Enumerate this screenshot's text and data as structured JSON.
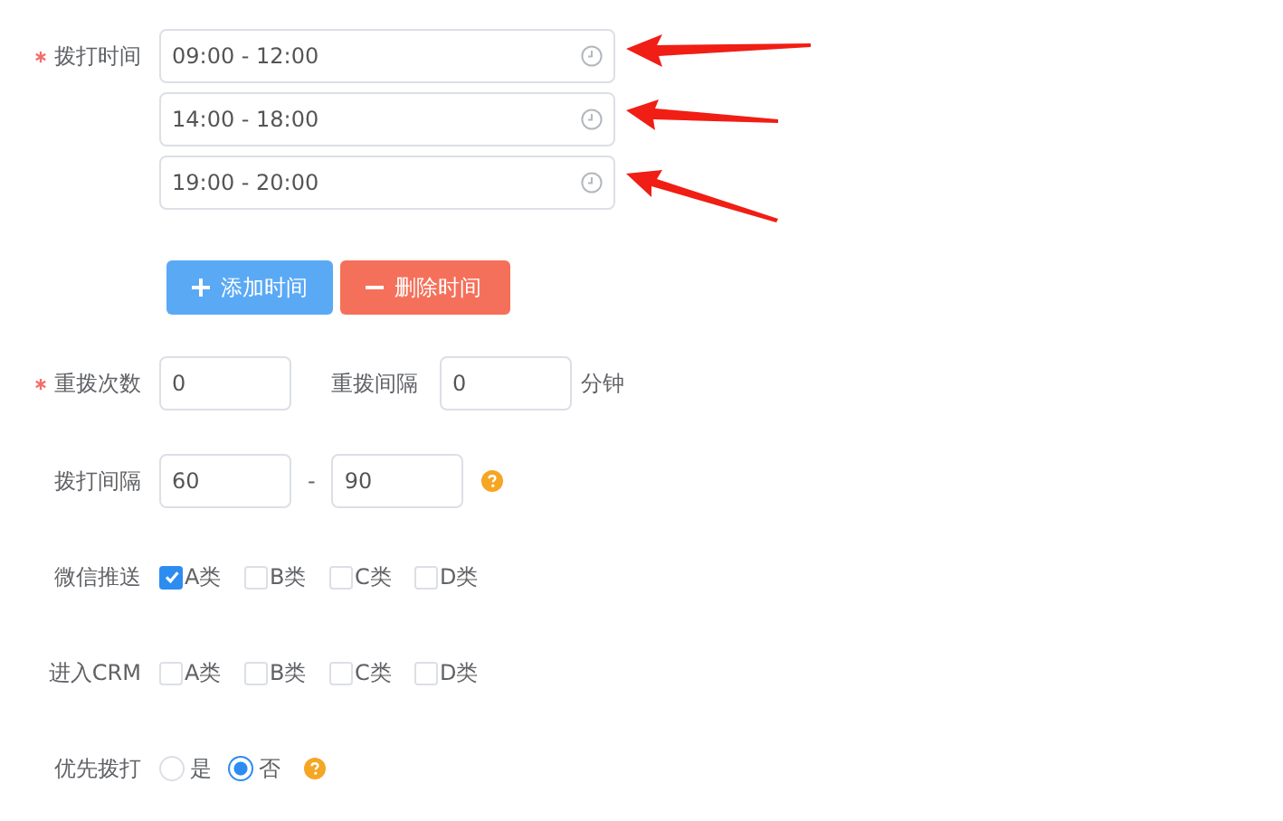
{
  "dial_time": {
    "label": "拨打时间",
    "required": true,
    "slots": [
      {
        "value": "09:00 - 12:00",
        "arrow": true
      },
      {
        "value": "14:00 - 18:00",
        "arrow": true
      },
      {
        "value": "19:00 - 20:00",
        "arrow": true
      }
    ]
  },
  "buttons": [
    {
      "label": "添加时间",
      "kind": "add"
    },
    {
      "label": "删除时间",
      "kind": "delete"
    }
  ],
  "redial": {
    "label": "重拨次数",
    "required": true,
    "value": "0",
    "interval_label": "重拨间隔",
    "interval_value": "0",
    "unit": "分钟"
  },
  "dial_interval": {
    "label": "拨打间隔",
    "required": false,
    "min": "60",
    "separator": "-",
    "max": "90",
    "help": true
  },
  "checkbox_groups": [
    {
      "label": "微信推送",
      "options": [
        {
          "label": "A类",
          "checked": true
        },
        {
          "label": "B类",
          "checked": false
        },
        {
          "label": "C类",
          "checked": false
        },
        {
          "label": "D类",
          "checked": false
        }
      ]
    },
    {
      "label": "进入CRM",
      "options": [
        {
          "label": "A类",
          "checked": false
        },
        {
          "label": "B类",
          "checked": false
        },
        {
          "label": "C类",
          "checked": false
        },
        {
          "label": "D类",
          "checked": false
        }
      ]
    }
  ],
  "priority": {
    "label": "优先拨打",
    "options": [
      {
        "label": "是",
        "selected": false
      },
      {
        "label": "否",
        "selected": true
      }
    ],
    "help": true
  }
}
